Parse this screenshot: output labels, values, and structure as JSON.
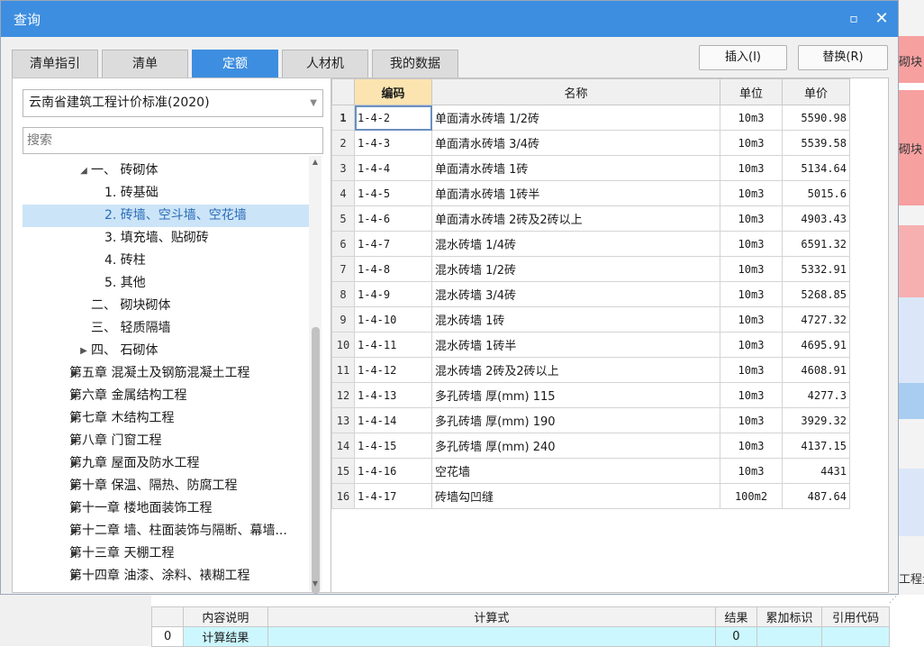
{
  "dialog": {
    "title": "查询",
    "tabs": [
      "清单指引",
      "清单",
      "定额",
      "人材机",
      "我的数据"
    ],
    "active_tab": 2,
    "insert_label": "插入(I)",
    "replace_label": "替换(R)"
  },
  "left": {
    "standard": "云南省建筑工程计价标准(2020)",
    "search_placeholder": "搜索",
    "tree": [
      {
        "label": "一、 砖砌体",
        "arrow": "◢",
        "indent": 1
      },
      {
        "label": "1. 砖基础",
        "arrow": "",
        "indent": 2
      },
      {
        "label": "2. 砖墙、空斗墙、空花墙",
        "arrow": "",
        "indent": 2,
        "selected": true
      },
      {
        "label": "3. 填充墙、贴砌砖",
        "arrow": "",
        "indent": 2
      },
      {
        "label": "4. 砖柱",
        "arrow": "",
        "indent": 2
      },
      {
        "label": "5. 其他",
        "arrow": "",
        "indent": 2
      },
      {
        "label": "二、 砌块砌体",
        "arrow": "",
        "indent": 1
      },
      {
        "label": "三、 轻质隔墙",
        "arrow": "",
        "indent": 1
      },
      {
        "label": "四、 石砌体",
        "arrow": "▶",
        "indent": 1
      },
      {
        "label": "第五章 混凝土及钢筋混凝土工程",
        "arrow": "▶",
        "indent": 0
      },
      {
        "label": "第六章 金属结构工程",
        "arrow": "▶",
        "indent": 0
      },
      {
        "label": "第七章 木结构工程",
        "arrow": "▶",
        "indent": 0
      },
      {
        "label": "第八章 门窗工程",
        "arrow": "▶",
        "indent": 0
      },
      {
        "label": "第九章 屋面及防水工程",
        "arrow": "▶",
        "indent": 0
      },
      {
        "label": "第十章 保温、隔热、防腐工程",
        "arrow": "▶",
        "indent": 0
      },
      {
        "label": "第十一章 楼地面装饰工程",
        "arrow": "▶",
        "indent": 0
      },
      {
        "label": "第十二章 墙、柱面装饰与隔断、幕墙...",
        "arrow": "▶",
        "indent": 0
      },
      {
        "label": "第十三章 天棚工程",
        "arrow": "▶",
        "indent": 0
      },
      {
        "label": "第十四章 油漆、涂料、裱糊工程",
        "arrow": "▶",
        "indent": 0
      }
    ]
  },
  "grid": {
    "headers": {
      "code": "编码",
      "name": "名称",
      "unit": "单位",
      "price": "单价"
    },
    "selected_row": 1,
    "rows": [
      {
        "no": "1",
        "code": "1-4-2",
        "name": "单面清水砖墙 1/2砖",
        "unit": "10m3",
        "price": "5590.98"
      },
      {
        "no": "2",
        "code": "1-4-3",
        "name": "单面清水砖墙 3/4砖",
        "unit": "10m3",
        "price": "5539.58"
      },
      {
        "no": "3",
        "code": "1-4-4",
        "name": "单面清水砖墙 1砖",
        "unit": "10m3",
        "price": "5134.64"
      },
      {
        "no": "4",
        "code": "1-4-5",
        "name": "单面清水砖墙 1砖半",
        "unit": "10m3",
        "price": "5015.6"
      },
      {
        "no": "5",
        "code": "1-4-6",
        "name": "单面清水砖墙 2砖及2砖以上",
        "unit": "10m3",
        "price": "4903.43"
      },
      {
        "no": "6",
        "code": "1-4-7",
        "name": "混水砖墙 1/4砖",
        "unit": "10m3",
        "price": "6591.32"
      },
      {
        "no": "7",
        "code": "1-4-8",
        "name": "混水砖墙 1/2砖",
        "unit": "10m3",
        "price": "5332.91"
      },
      {
        "no": "8",
        "code": "1-4-9",
        "name": "混水砖墙 3/4砖",
        "unit": "10m3",
        "price": "5268.85"
      },
      {
        "no": "9",
        "code": "1-4-10",
        "name": "混水砖墙 1砖",
        "unit": "10m3",
        "price": "4727.32"
      },
      {
        "no": "10",
        "code": "1-4-11",
        "name": "混水砖墙 1砖半",
        "unit": "10m3",
        "price": "4695.91"
      },
      {
        "no": "11",
        "code": "1-4-12",
        "name": "混水砖墙 2砖及2砖以上",
        "unit": "10m3",
        "price": "4608.91"
      },
      {
        "no": "12",
        "code": "1-4-13",
        "name": "多孔砖墙 厚(mm) 115",
        "unit": "10m3",
        "price": "4277.3"
      },
      {
        "no": "13",
        "code": "1-4-14",
        "name": "多孔砖墙 厚(mm) 190",
        "unit": "10m3",
        "price": "3929.32"
      },
      {
        "no": "14",
        "code": "1-4-15",
        "name": "多孔砖墙 厚(mm) 240",
        "unit": "10m3",
        "price": "4137.15"
      },
      {
        "no": "15",
        "code": "1-4-16",
        "name": "空花墙",
        "unit": "10m3",
        "price": "4431"
      },
      {
        "no": "16",
        "code": "1-4-17",
        "name": "砖墙勾凹缝",
        "unit": "100m2",
        "price": "487.64"
      }
    ]
  },
  "background": {
    "right_texts": [
      "砌块",
      "砌块",
      "工程量"
    ],
    "bottom_headers": [
      "内容说明",
      "计算式",
      "结果",
      "累加标识",
      "引用代码"
    ],
    "bottom_row": {
      "no": "0",
      "desc": "计算结果",
      "result": "0"
    }
  }
}
